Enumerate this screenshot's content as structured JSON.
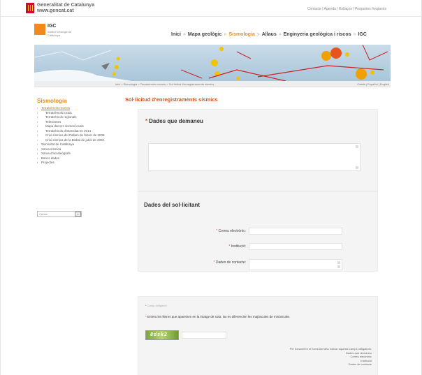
{
  "gov": {
    "name": "Generalitat de Catalunya",
    "url": "www.gencat.cat",
    "links": "Contacte | Agenda | Enllaços | Preguntes freqüents"
  },
  "brand": {
    "logo_text": "IGC",
    "sub_text": "Institut Geològic de Catalunya"
  },
  "nav": {
    "items": [
      {
        "label": "Inici",
        "active": false
      },
      {
        "label": "Mapa geològic",
        "active": false
      },
      {
        "label": "Sismologia",
        "active": true
      },
      {
        "label": "Allaus",
        "active": false
      },
      {
        "label": "Enginyeria geològica i riscos",
        "active": false
      },
      {
        "label": "IGC",
        "active": false
      }
    ],
    "separator": "»"
  },
  "breadcrumb": "Inici > Sismologia > Terratrèmols recents > Sol·licitud d'enregistraments sísmics",
  "languages": "Català | Español | English",
  "sidebar": {
    "title": "Sismologia",
    "items": [
      {
        "label": "Terratrèmols recents",
        "active": true
      },
      {
        "label": "Terratrèmols locals",
        "sub": true
      },
      {
        "label": "Terratrèmols regionals",
        "sub": true
      },
      {
        "label": "Telesismes",
        "sub": true
      },
      {
        "label": "Mapa darrers sismes locals",
        "sub": true
      },
      {
        "label": "Terratrèmols d'intensitat en 2014",
        "sub": true
      },
      {
        "label": "Crisi sísmica del Pallars de febrer de 2003",
        "sub": true
      },
      {
        "label": "Crisi sísmica de la Bisbal de juliol de 2002",
        "sub": true
      },
      {
        "label": "Sismicitat de Catalunya"
      },
      {
        "label": "Xarxa sísmica"
      },
      {
        "label": "Xarxa d'acceleògrafs"
      },
      {
        "label": "Bancs dades"
      },
      {
        "label": "Projectes"
      }
    ],
    "search_value": "Cercar",
    "search_button": "»"
  },
  "page_title": "Sol·licitud d'enregistraments sísmics",
  "form": {
    "section1_label": "Dades que demaneu",
    "section2_title": "Dades del sol·licitant",
    "fields": [
      {
        "label": "Correu electrònic:",
        "name": "email-field"
      },
      {
        "label": "Institució:",
        "name": "institution-field"
      },
      {
        "label": "Dades de contacte:",
        "name": "contact-field"
      }
    ],
    "captcha_label": "Camp obligatori",
    "captcha_text": "Entreu les lletres que apareixen en la imatge de sota. No es diferencien les majúscules de minúscules",
    "required_notes": [
      "Per transmetre el formulari falta indicar aquests camps obligatoris:",
      "Dades que demaneu",
      "Correu electrònic",
      "Institució",
      "Dades de contacte"
    ]
  },
  "colors": {
    "accent": "#f08a1e",
    "title": "#d0531f",
    "panel_bg": "#f4f4f4"
  }
}
